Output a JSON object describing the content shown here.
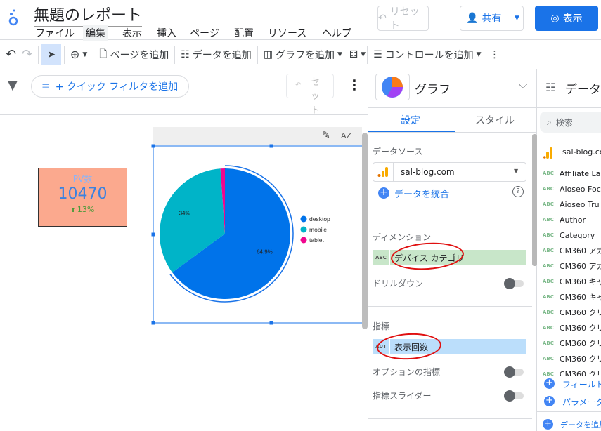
{
  "header": {
    "title": "無題のレポート",
    "menu": [
      "ファイル",
      "編集",
      "表示",
      "挿入",
      "ページ",
      "配置",
      "リソース",
      "ヘルプ"
    ],
    "reset": "リセット",
    "share": "共有",
    "view": "表示"
  },
  "toolbar": {
    "add_page": "ページを追加",
    "add_data": "データを追加",
    "add_chart": "グラフを追加",
    "add_control": "コントロールを追加"
  },
  "filterbar": {
    "quick_filter": "+ クイック フィルタを追加",
    "reset_vertical": "セット"
  },
  "scorecard": {
    "label": "PV数",
    "value": "10470",
    "delta": "13%",
    "bg": "#fba98e"
  },
  "chart_data": {
    "type": "pie",
    "categories": [
      "desktop",
      "mobile",
      "tablet"
    ],
    "values": [
      64.9,
      34,
      1.1
    ],
    "labels": [
      "64.9%",
      "34%",
      ""
    ],
    "colors": [
      "#0073ea",
      "#00b4c8",
      "#f0068f"
    ],
    "legend": "right"
  },
  "mid": {
    "title": "グラフ",
    "tabs": [
      "設定",
      "スタイル"
    ],
    "datasource_label": "データソース",
    "datasource": "sal-blog.com",
    "blend": "データを統合",
    "dimension_label": "ディメンション",
    "dimension": "デバイス カテゴリ",
    "dimension_type": "ABC",
    "drilldown": "ドリルダウン",
    "metric_label": "指標",
    "metric": "表示回数",
    "metric_type": "AUT",
    "optional_metric": "オプションの指標",
    "metric_slider": "指標スライダー"
  },
  "right": {
    "title": "データ",
    "search": "検索",
    "source": "sal-blog.com",
    "fields": [
      "Affiliate Lab",
      "Aioseo Foc",
      "Aioseo Tru",
      "Author",
      "Category",
      "CM360 アカ",
      "CM360 アカ",
      "CM360 キャ",
      "CM360 キャ",
      "CM360 クリ",
      "CM360 クリ",
      "CM360 クリ",
      "CM360 クリ",
      "CM360 クリ"
    ],
    "add_field": "フィールド",
    "add_param": "パラメータ",
    "add_data": "データを追加"
  }
}
